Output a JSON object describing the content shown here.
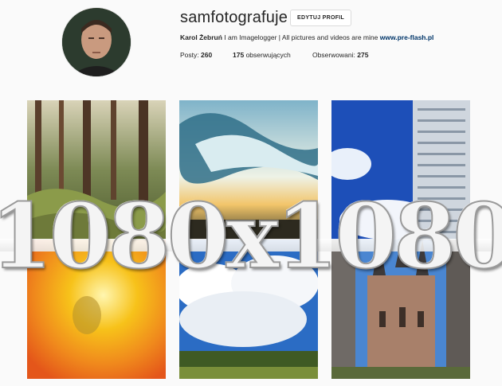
{
  "profile": {
    "username": "samfotografuje",
    "edit_button": "EDYTUJ PROFIL",
    "bio": {
      "name": "Karol Żebruń",
      "text": " I am Imagelogger | All pictures and videos are mine ",
      "link": "www.pre-flash.pl"
    },
    "stats": {
      "posts_label": "Posty:",
      "posts_value": "260",
      "followers_value": "175",
      "followers_label": "obserwujących",
      "following_label": "Obserwowani:",
      "following_value": "275"
    }
  },
  "watermark": {
    "text": "1080x1080"
  },
  "posts": [
    {
      "name": "forest-photo"
    },
    {
      "name": "clouds-sunset-photo"
    },
    {
      "name": "skyscraper-photo"
    },
    {
      "name": "orange-abstract-photo"
    },
    {
      "name": "cumulus-clouds-photo"
    },
    {
      "name": "cathedral-photo"
    }
  ],
  "colors": {
    "background": "#fafafa",
    "link": "#003569",
    "border": "#dbdbdb"
  }
}
